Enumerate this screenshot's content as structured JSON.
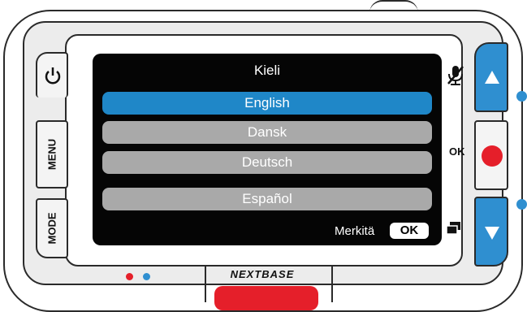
{
  "menu": {
    "title": "Kieli",
    "items": [
      {
        "label": "English",
        "selected": true
      },
      {
        "label": "Dansk",
        "selected": false
      },
      {
        "label": "Deutsch",
        "selected": false
      },
      {
        "label": "Español",
        "selected": false
      }
    ],
    "hint_label": "Merkitä",
    "hint_key": "OK"
  },
  "device": {
    "brand": "NEXTBASE",
    "buttons": {
      "menu": "MENU",
      "mode": "MODE",
      "ok": "OK"
    },
    "icons": {
      "power": "power-icon",
      "up": "triangle-up-icon",
      "down": "triangle-down-icon",
      "record": "record-icon",
      "mic": "microphone-muted-icon",
      "screen_toggle": "screen-toggle-icon"
    },
    "colors": {
      "accent_blue": "#1f87c8",
      "record_red": "#e51f2a",
      "menu_item_grey": "#a9a9a9"
    }
  }
}
